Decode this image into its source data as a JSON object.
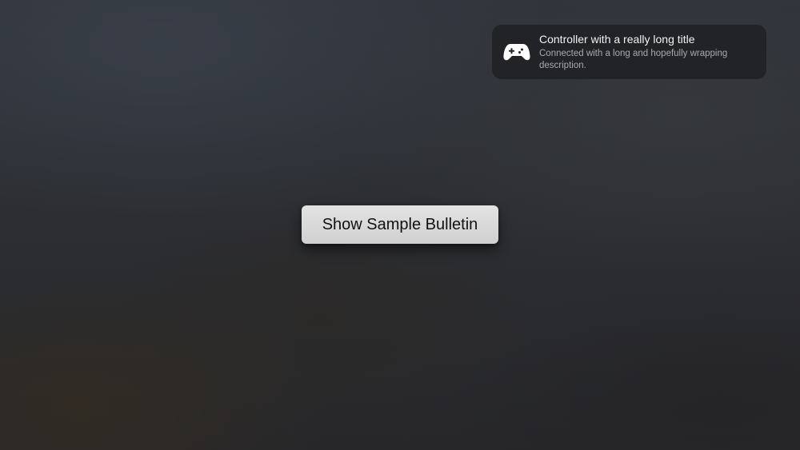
{
  "bulletin": {
    "icon": "game-controller-icon",
    "title": "Controller with a really long title",
    "description": "Connected with a long and hopefully wrapping description."
  },
  "main": {
    "button_label": "Show Sample Bulletin"
  },
  "colors": {
    "bulletin_background": "#202124",
    "button_background": "#d9d9d9",
    "button_text": "#111111",
    "title_text": "#f2f2f2",
    "description_text": "#a9a9ab"
  }
}
